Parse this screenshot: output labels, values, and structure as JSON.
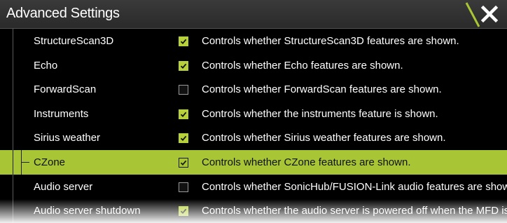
{
  "window": {
    "title": "Advanced Settings",
    "close_icon": "close-icon",
    "accent_color": "#a8c536"
  },
  "settings": [
    {
      "name": "StructureScan3D",
      "checked": true,
      "description": "Controls whether StructureScan3D features are shown."
    },
    {
      "name": "Echo",
      "checked": true,
      "description": "Controls whether Echo features are shown."
    },
    {
      "name": "ForwardScan",
      "checked": false,
      "description": "Controls whether ForwardScan features are shown."
    },
    {
      "name": "Instruments",
      "checked": true,
      "description": "Controls whether the instruments feature is shown."
    },
    {
      "name": "Sirius weather",
      "checked": true,
      "description": "Controls whether Sirius weather features are shown."
    },
    {
      "name": "CZone",
      "checked": true,
      "description": "Controls whether CZone features are shown.",
      "selected": true
    },
    {
      "name": "Audio server",
      "checked": false,
      "description": "Controls whether SonicHub/FUSION-Link audio features are shown."
    },
    {
      "name": "Audio server shutdown",
      "checked": true,
      "description": "Controls whether the audio server is powered off when the MFD is shut down."
    }
  ]
}
